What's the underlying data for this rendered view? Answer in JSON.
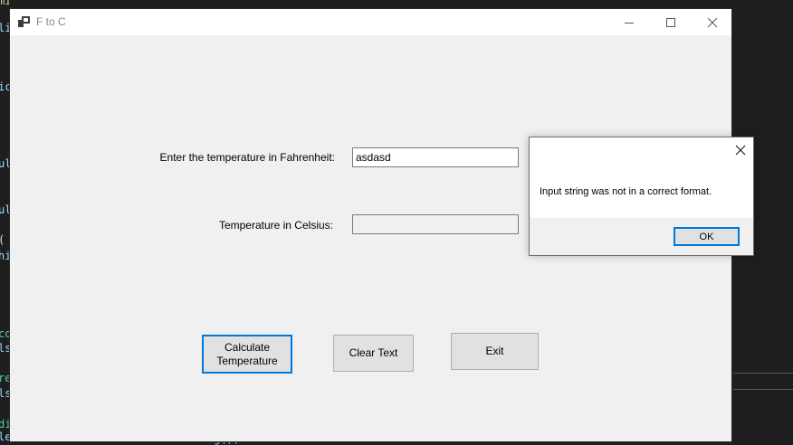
{
  "background": {
    "code_fragments": [
      "mi()",
      "li",
      "ic",
      "ul",
      "ul",
      "(",
      "hi",
      "co",
      "ls",
      "re",
      "ls",
      "di",
      "le"
    ],
    "bottom_line": "lelsbWrite.text   setsDDS.Toatring();"
  },
  "window": {
    "title": "F to C",
    "icon": "app-form-icon",
    "controls": [
      "minimize-icon",
      "maximize-icon",
      "close-icon"
    ]
  },
  "form": {
    "fahrenheit_label": "Enter the temperature in Fahrenheit:",
    "fahrenheit_value": "asdasd",
    "celsius_label": "Temperature in Celsius:",
    "celsius_value": ""
  },
  "buttons": {
    "calculate_line1": "Calculate",
    "calculate_line2": "Temperature",
    "clear": "Clear Text",
    "exit": "Exit"
  },
  "message_box": {
    "text": "Input string was not in a correct format.",
    "ok_label": "OK"
  },
  "colors": {
    "accent": "#0078d7",
    "window_bg": "#f0f0f0",
    "editor_bg": "#1e1e1e"
  }
}
